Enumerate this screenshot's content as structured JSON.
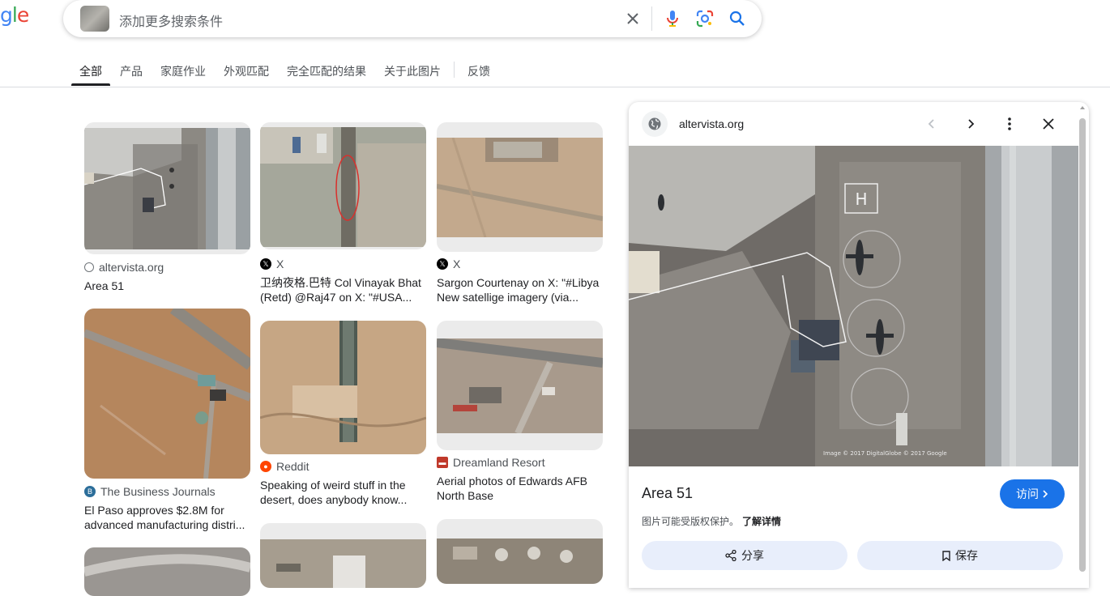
{
  "logo": {
    "letters": [
      "g",
      "l",
      "e"
    ]
  },
  "search": {
    "placeholder": "添加更多搜索条件"
  },
  "icons": {
    "clear": "close-icon",
    "voice": "microphone-icon",
    "lens": "lens-icon",
    "search": "search-icon"
  },
  "colors": {
    "accent": "#1a73e8",
    "pill_bg": "#e8eefb"
  },
  "tabs": [
    {
      "label": "全部",
      "active": true
    },
    {
      "label": "产品"
    },
    {
      "label": "家庭作业"
    },
    {
      "label": "外观匹配"
    },
    {
      "label": "完全匹配的结果"
    },
    {
      "label": "关于此图片"
    },
    {
      "label": "反馈"
    }
  ],
  "results": [
    {
      "source": "altervista.org",
      "title": "Area 51"
    },
    {
      "source": "X",
      "title": "卫纳夜格.巴特 Col Vinayak Bhat (Retd) @Raj47 on X: \"#USA..."
    },
    {
      "source": "X",
      "title": "Sargon Courtenay on X: \"#Libya New satellige imagery (via..."
    },
    {
      "source": "The Business Journals",
      "title": "El Paso approves $2.8M for advanced manufacturing distri..."
    },
    {
      "source": "Reddit",
      "title": "Speaking of weird stuff in the desert, does anybody know..."
    },
    {
      "source": "Dreamland Resort",
      "title": "Aerial photos of Edwards AFB North Base"
    }
  ],
  "panel": {
    "site": "altervista.org",
    "title": "Area 51",
    "visit_label": "访问",
    "copyright_note": "图片可能受版权保护。",
    "learn_more": "了解详情",
    "share_label": "分享",
    "save_label": "保存",
    "image_credit": "Image © 2017 DigitalGlobe © 2017 Google"
  }
}
